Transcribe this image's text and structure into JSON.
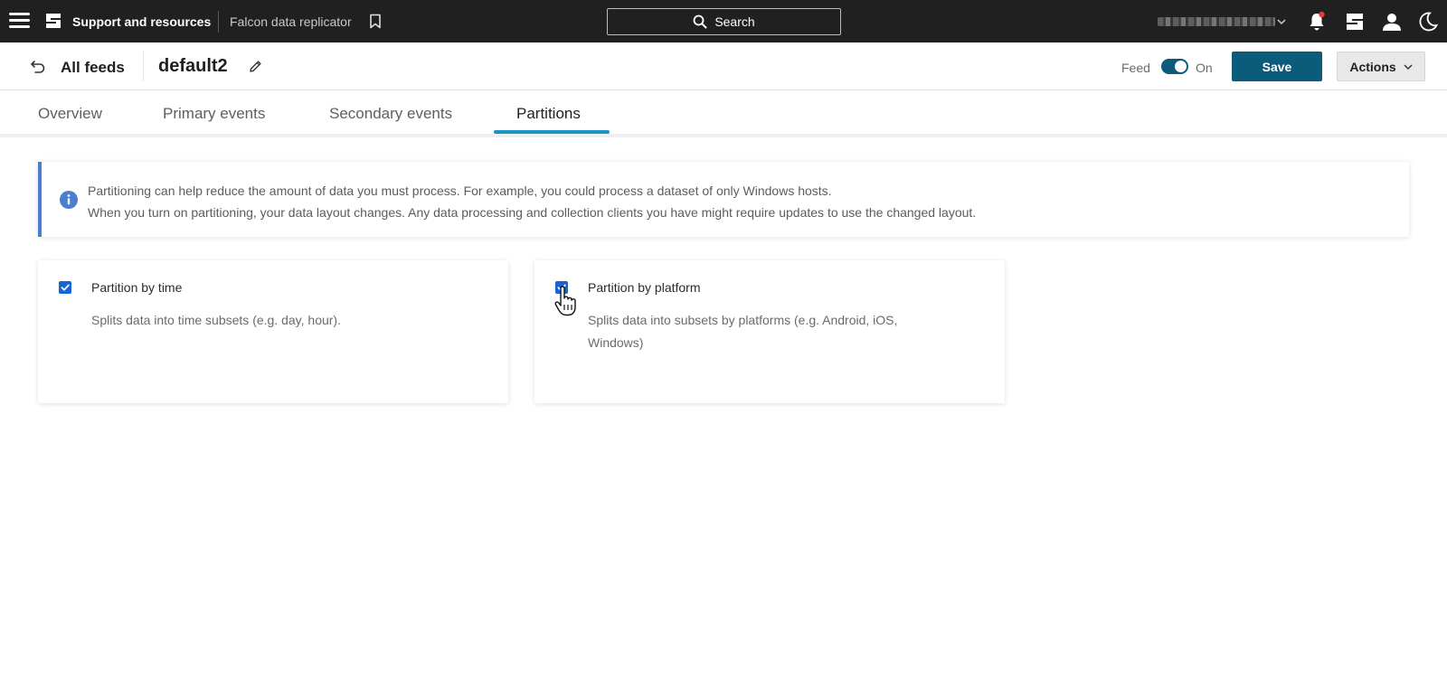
{
  "topbar": {
    "brand": "Support and resources",
    "app_name": "Falcon data replicator",
    "search_label": "Search",
    "notification_dot_color": "#e53935"
  },
  "header": {
    "back_label": "All feeds",
    "feed_name": "default2",
    "feed_label": "Feed",
    "feed_state": "On",
    "feed_enabled": true,
    "save_label": "Save",
    "actions_label": "Actions"
  },
  "tabs": [
    {
      "label": "Overview",
      "active": false
    },
    {
      "label": "Primary events",
      "active": false
    },
    {
      "label": "Secondary events",
      "active": false
    },
    {
      "label": "Partitions",
      "active": true
    }
  ],
  "info": {
    "line1": "Partitioning can help reduce the amount of data you must process. For example, you could process a dataset of only Windows hosts.",
    "line2": "When you turn on partitioning, your data layout changes. Any data processing and collection clients you have might require updates to use the changed layout."
  },
  "partitions": [
    {
      "title": "Partition by time",
      "description": "Splits data into time subsets (e.g. day, hour).",
      "checked": true
    },
    {
      "title": "Partition by platform",
      "description": "Splits data into subsets by platforms (e.g. Android, iOS, Windows)",
      "checked": true
    }
  ],
  "colors": {
    "topbar_bg": "#202020",
    "primary": "#0b5b7a",
    "tab_accent": "#1a94c4",
    "info_accent": "#4a7fcf",
    "checkbox": "#1565d8"
  }
}
